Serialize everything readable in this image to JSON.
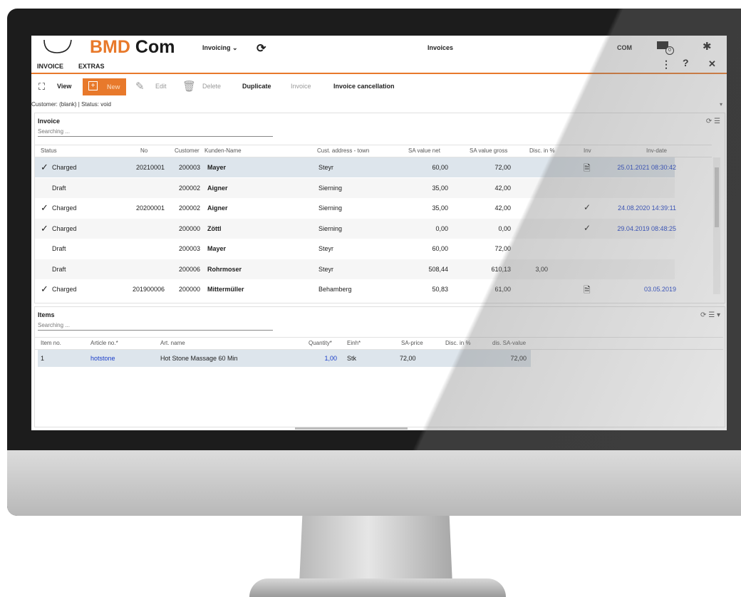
{
  "header": {
    "logo_text_orange": "BMD",
    "logo_text_dark": "Com",
    "tabs": [
      "INVOICE",
      "EXTRAS"
    ],
    "menu": "Invoicing",
    "title": "Invoices",
    "user": "COM",
    "mail_count": "0"
  },
  "toolbar": {
    "view": "View",
    "new": "New",
    "edit": "Edit",
    "delete": "Delete",
    "duplicate": "Duplicate",
    "invoice": "Invoice",
    "invoice_cancellation": "Invoice cancellation"
  },
  "status_line": "Customer: (blank) | Status: void",
  "invoice_panel": {
    "title": "Invoice",
    "search_placeholder": "Searching ...",
    "columns": [
      "Status",
      "No",
      "Customer",
      "Kunden-Name",
      "Cust. address - town",
      "SA value net",
      "SA value gross",
      "Disc. in %",
      "Inv",
      "Inv-date"
    ],
    "rows": [
      {
        "status": "Charged",
        "charged": true,
        "no": "20210001",
        "customer": "200003",
        "name": "Mayer",
        "town": "Steyr",
        "net": "60,00",
        "gross": "72,00",
        "disc": "",
        "inv": "doc",
        "date": "25.01.2021 08:30:42"
      },
      {
        "status": "Draft",
        "charged": false,
        "no": "",
        "customer": "200002",
        "name": "Aigner",
        "town": "Sierning",
        "net": "35,00",
        "gross": "42,00",
        "disc": "",
        "inv": "",
        "date": ""
      },
      {
        "status": "Charged",
        "charged": true,
        "no": "20200001",
        "customer": "200002",
        "name": "Aigner",
        "town": "Sierning",
        "net": "35,00",
        "gross": "42,00",
        "disc": "",
        "inv": "check",
        "date": "24.08.2020 14:39:11"
      },
      {
        "status": "Charged",
        "charged": true,
        "no": "",
        "customer": "200000",
        "name": "Zöttl",
        "town": "Sierning",
        "net": "0,00",
        "gross": "0,00",
        "disc": "",
        "inv": "check",
        "date": "29.04.2019 08:48:25"
      },
      {
        "status": "Draft",
        "charged": false,
        "no": "",
        "customer": "200003",
        "name": "Mayer",
        "town": "Steyr",
        "net": "60,00",
        "gross": "72,00",
        "disc": "",
        "inv": "",
        "date": ""
      },
      {
        "status": "Draft",
        "charged": false,
        "no": "",
        "customer": "200006",
        "name": "Rohrmoser",
        "town": "Steyr",
        "net": "508,44",
        "gross": "610,13",
        "disc": "3,00",
        "inv": "",
        "date": ""
      },
      {
        "status": "Charged",
        "charged": true,
        "no": "201900006",
        "customer": "200000",
        "name": "Mittermüller",
        "town": "Behamberg",
        "net": "50,83",
        "gross": "61,00",
        "disc": "",
        "inv": "doc",
        "date": "03.05.2019"
      }
    ]
  },
  "items_panel": {
    "title": "Items",
    "search_placeholder": "Searching ...",
    "columns": [
      "Item no.",
      "Article no.*",
      "Art. name",
      "Quantity*",
      "Einh*",
      "SA-price",
      "Disc. in %",
      "dis. SA-value"
    ],
    "rows": [
      {
        "item_no": "1",
        "article_no": "hotstone",
        "art_name": "Hot Stone Massage 60 Min",
        "quantity": "1,00",
        "unit": "Stk",
        "price": "72,00",
        "disc": "",
        "value": "72,00"
      }
    ]
  },
  "colors": {
    "accent": "#e8792b",
    "link": "#1a3ec9",
    "selected_row": "#dde5ec",
    "bezel": "#1c1c1c"
  }
}
